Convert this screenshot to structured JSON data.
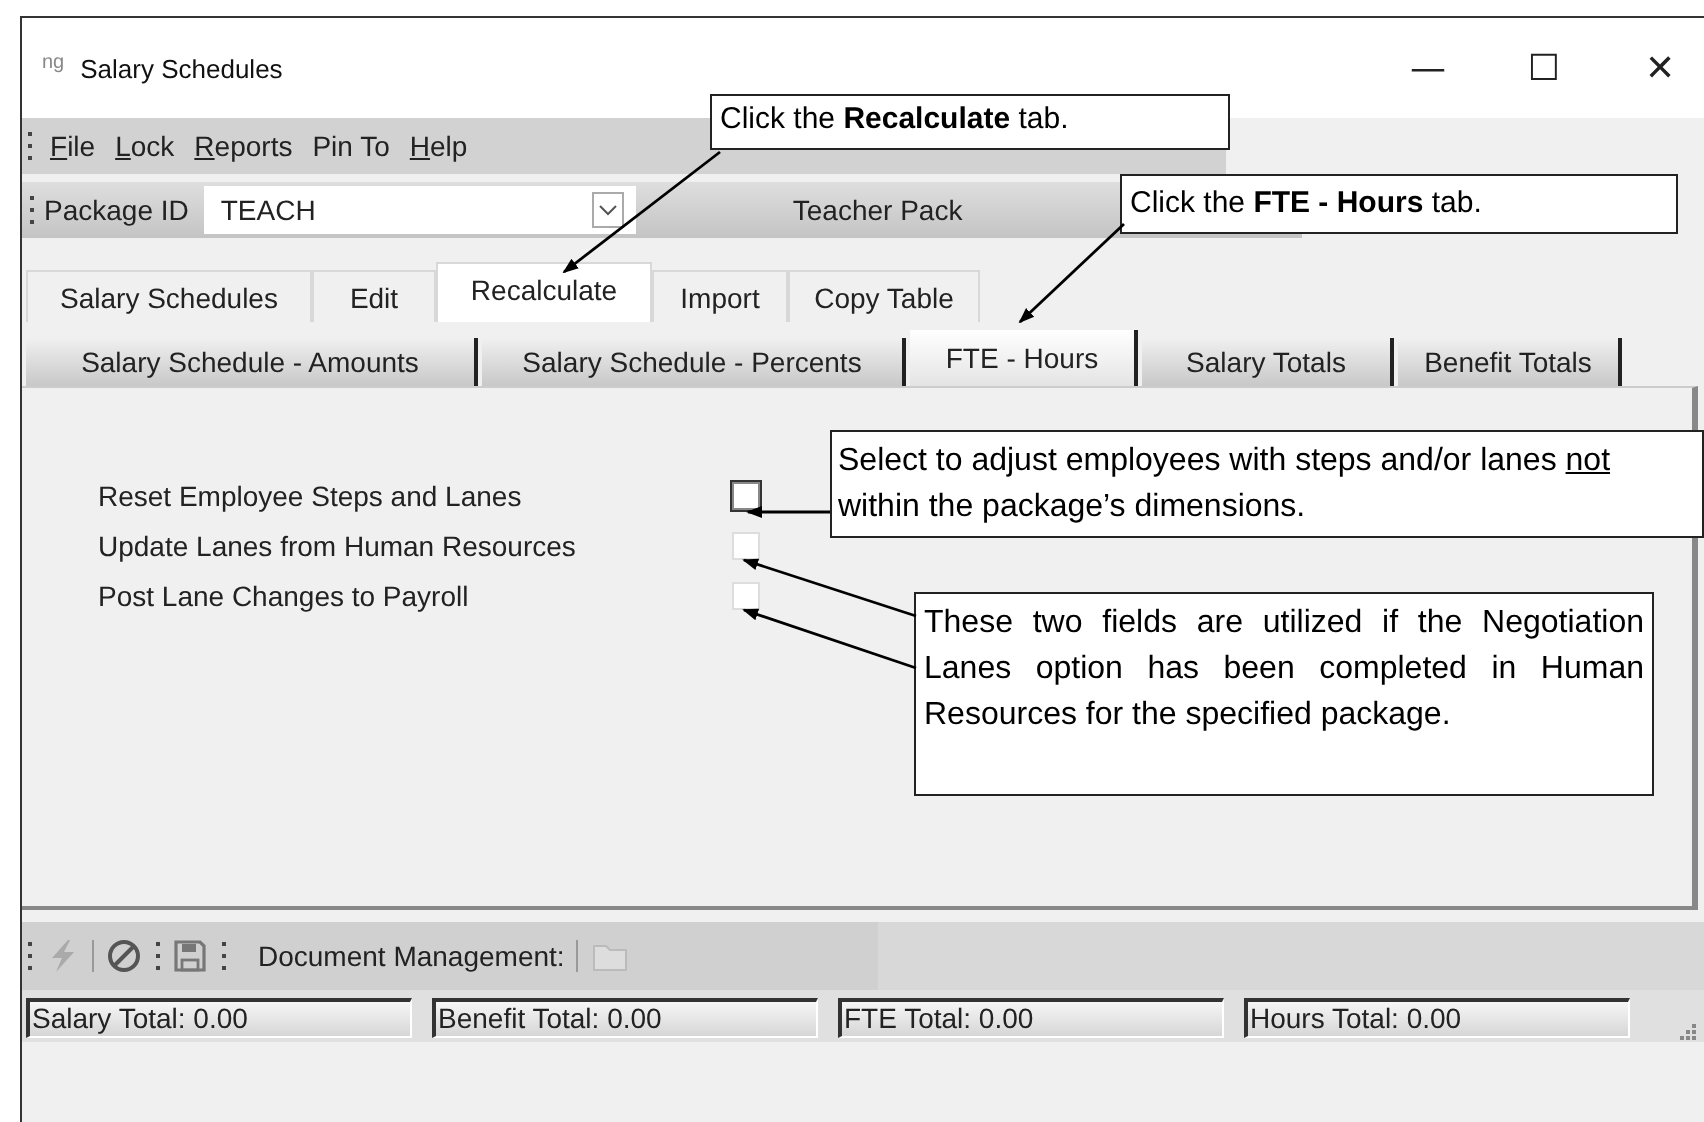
{
  "window": {
    "logo": "ng",
    "title": "Salary Schedules",
    "controls": [
      "—",
      "☐",
      "✕"
    ]
  },
  "menu": [
    {
      "parts": [
        {
          "text": "F",
          "underline": true
        },
        {
          "text": "ile"
        }
      ]
    },
    {
      "parts": [
        {
          "text": "L",
          "underline": true
        },
        {
          "text": "ock"
        }
      ]
    },
    {
      "parts": [
        {
          "text": "R",
          "underline": true
        },
        {
          "text": "eports"
        }
      ]
    },
    {
      "parts": [
        {
          "text": "Pin To"
        }
      ]
    },
    {
      "parts": [
        {
          "text": "H",
          "underline": true
        },
        {
          "text": "elp"
        }
      ]
    }
  ],
  "package": {
    "label": "Package ID",
    "value": "TEACH",
    "description": "Teacher Pack"
  },
  "tabs": [
    {
      "label": "Salary Schedules",
      "selected": false
    },
    {
      "label": "Edit",
      "selected": false
    },
    {
      "label": "Recalculate",
      "selected": true
    },
    {
      "label": "Import",
      "selected": false
    },
    {
      "label": "Copy Table",
      "selected": false
    }
  ],
  "subtabs": [
    {
      "label": "Salary Schedule - Amounts",
      "selected": false
    },
    {
      "label": "Salary Schedule - Percents",
      "selected": false
    },
    {
      "label": "FTE - Hours",
      "selected": true
    },
    {
      "label": "Salary Totals",
      "selected": false
    },
    {
      "label": "Benefit Totals",
      "selected": false
    }
  ],
  "options": [
    {
      "label": "Reset Employee Steps and Lanes",
      "checked": false,
      "focused": true
    },
    {
      "label": "Update Lanes from Human Resources",
      "checked": false,
      "focused": false
    },
    {
      "label": "Post Lane Changes to Payroll",
      "checked": false,
      "focused": false
    }
  ],
  "toolbar": {
    "document_label": "Document Management:"
  },
  "status_bar": [
    "Salary Total: 0.00",
    "Benefit Total: 0.00",
    "FTE Total: 0.00",
    "Hours Total: 0.00"
  ],
  "callouts": [
    {
      "parts": [
        {
          "text": "Click the "
        },
        {
          "text": "Recalculate",
          "bold": true
        },
        {
          "text": " tab."
        }
      ]
    },
    {
      "parts": [
        {
          "text": "Click the "
        },
        {
          "text": "FTE - Hours",
          "bold": true
        },
        {
          "text": " tab."
        }
      ]
    },
    {
      "parts": [
        {
          "text": "Select to adjust employees with steps and/or lanes "
        },
        {
          "text": "not",
          "underline": true
        },
        {
          "text": " within the package’s dimensions."
        }
      ]
    },
    {
      "parts": [
        {
          "text": "These two fields are utilized if the Negotiation Lanes option has been completed in Human Resources for the specified package."
        }
      ]
    }
  ]
}
